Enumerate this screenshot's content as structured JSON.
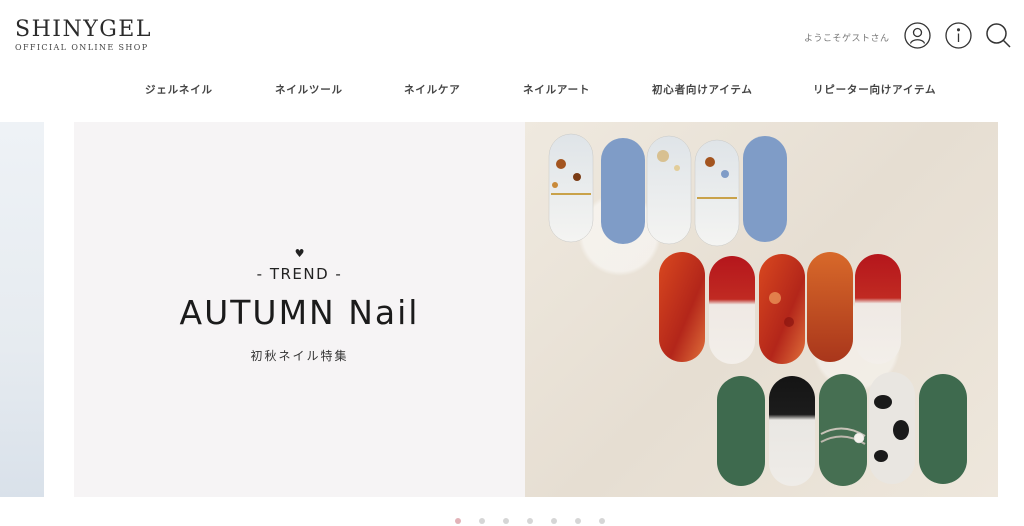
{
  "header": {
    "logo_main": "SHINYGEL",
    "logo_sub": "OFFICIAL ONLINE SHOP",
    "greeting": "ようこそゲストさん",
    "icons": [
      "user-icon",
      "info-icon",
      "search-icon"
    ]
  },
  "nav": {
    "items": [
      {
        "label": "ジェルネイル"
      },
      {
        "label": "ネイルツール"
      },
      {
        "label": "ネイルケア"
      },
      {
        "label": "ネイルアート"
      },
      {
        "label": "初心者向けアイテム"
      },
      {
        "label": "リピーター向けアイテム"
      }
    ]
  },
  "hero": {
    "heart": "♥",
    "tag": "- TREND -",
    "headline": "AUTUMN Nail",
    "subtitle": "初秋ネイル特集"
  },
  "slider": {
    "dot_count": 7,
    "active_index": 0
  },
  "colors": {
    "active_dot": "#e2b3b8",
    "inactive_dot": "#d6d6d6",
    "blue_nail": "#7f9cc7",
    "red_nail": "#b5241a",
    "green_nail": "#3e6a4e"
  }
}
